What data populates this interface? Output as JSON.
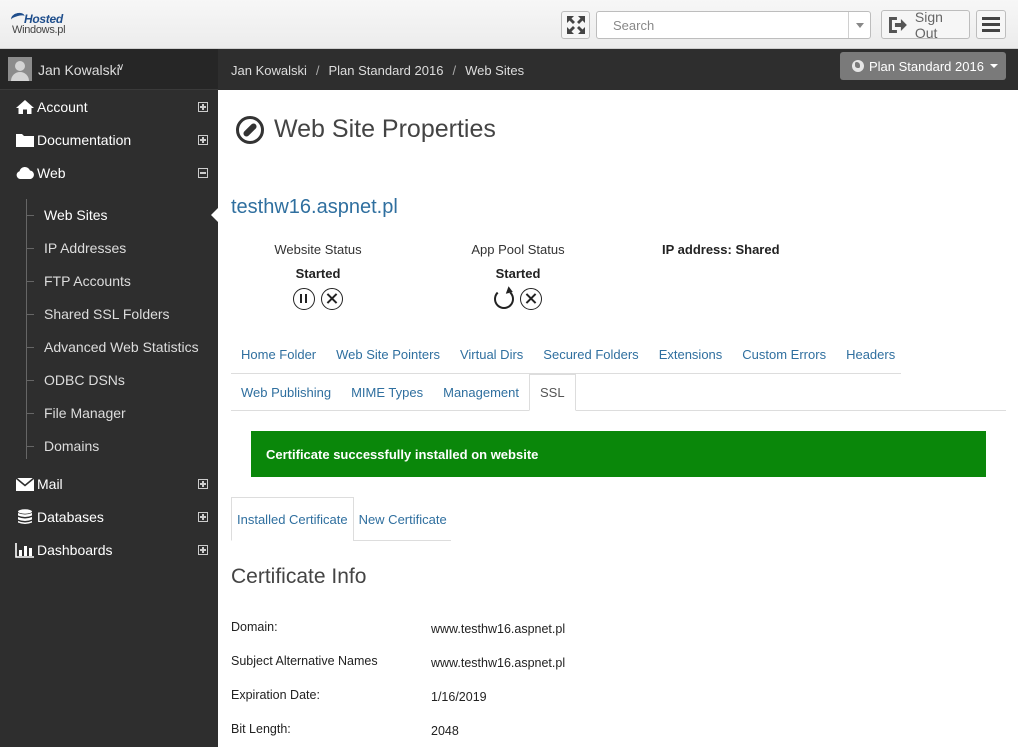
{
  "topbar": {
    "logo_line1": "Hosted",
    "logo_line2": "Windows.pl",
    "search_placeholder": "Search",
    "signout_label": "Sign Out"
  },
  "sidebar": {
    "user_name": "Jan Kowalski",
    "items": [
      {
        "label": "Account",
        "icon": "home-icon",
        "expanded": false
      },
      {
        "label": "Documentation",
        "icon": "folder-icon",
        "expanded": false
      },
      {
        "label": "Web",
        "icon": "cloud-icon",
        "expanded": true
      },
      {
        "label": "Mail",
        "icon": "envelope-icon",
        "expanded": false
      },
      {
        "label": "Databases",
        "icon": "database-icon",
        "expanded": false
      },
      {
        "label": "Dashboards",
        "icon": "bar-chart-icon",
        "expanded": false
      }
    ],
    "web_subitems": [
      {
        "label": "Web Sites",
        "active": true
      },
      {
        "label": "IP Addresses"
      },
      {
        "label": "FTP Accounts"
      },
      {
        "label": "Shared SSL Folders"
      },
      {
        "label": "Advanced Web Statistics"
      },
      {
        "label": "ODBC DSNs"
      },
      {
        "label": "File Manager"
      },
      {
        "label": "Domains"
      }
    ]
  },
  "breadcrumb": [
    "Jan Kowalski",
    "Plan Standard 2016",
    "Web Sites"
  ],
  "plan_selector": "Plan Standard 2016",
  "page": {
    "title": "Web Site Properties",
    "site_name": "testhw16.aspnet.pl",
    "website_status_label": "Website Status",
    "website_status_value": "Started",
    "app_pool_status_label": "App Pool Status",
    "app_pool_status_value": "Started",
    "ip_address": "IP address: Shared"
  },
  "tabs_row1": [
    "Home Folder",
    "Web Site Pointers",
    "Virtual Dirs",
    "Secured Folders",
    "Extensions",
    "Custom Errors",
    "Headers"
  ],
  "tabs_row2": [
    "Web Publishing",
    "MIME Types",
    "Management",
    "SSL"
  ],
  "active_tab": "SSL",
  "alert": {
    "text": "Certificate successfully installed on website",
    "color": "#0a870a"
  },
  "cert_tabs": [
    "Installed Certificate",
    "New Certificate"
  ],
  "certificate_info": {
    "title": "Certificate Info",
    "rows": [
      {
        "key": "Domain:",
        "value": "www.testhw16.aspnet.pl"
      },
      {
        "key": "Subject Alternative Names",
        "value": "www.testhw16.aspnet.pl"
      },
      {
        "key": "Expiration Date:",
        "value": "1/16/2019"
      },
      {
        "key": "Bit Length:",
        "value": "2048"
      }
    ]
  },
  "colors": {
    "accent_link": "#2f6f9f",
    "sidebar_bg": "#2e2e2e",
    "success": "#0a870a"
  }
}
